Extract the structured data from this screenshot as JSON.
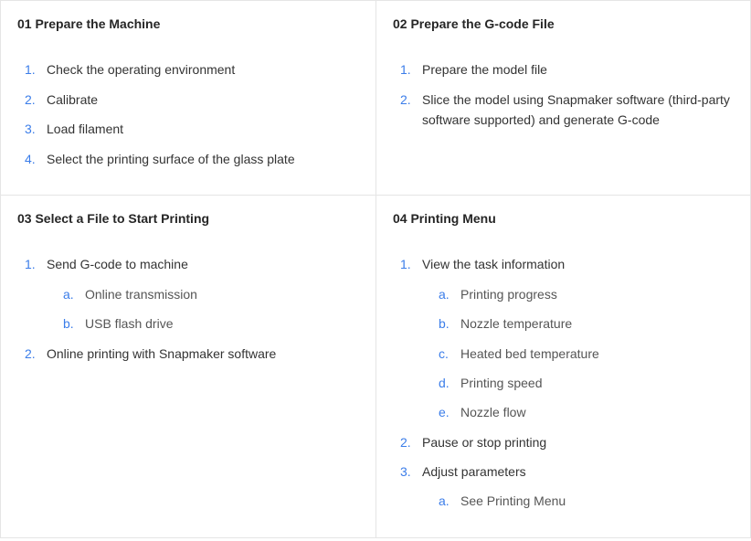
{
  "cells": [
    {
      "title": "01 Prepare the Machine",
      "items": [
        {
          "text": "Check the operating environment"
        },
        {
          "text": "Calibrate"
        },
        {
          "text": "Load filament"
        },
        {
          "text": "Select the printing surface of the glass plate"
        }
      ]
    },
    {
      "title": "02 Prepare the G-code File",
      "items": [
        {
          "text": "Prepare the model file"
        },
        {
          "text": "Slice the model using Snapmaker software (third-party software supported) and generate G-code"
        }
      ]
    },
    {
      "title": "03 Select a File to Start Printing",
      "items": [
        {
          "text": "Send G-code to machine",
          "subitems": [
            "Online transmission",
            "USB flash drive"
          ]
        },
        {
          "text": "Online printing with Snapmaker software"
        }
      ]
    },
    {
      "title": "04 Printing Menu",
      "items": [
        {
          "text": "View the task information",
          "subitems": [
            "Printing progress",
            "Nozzle temperature",
            "Heated bed temperature",
            "Printing speed",
            "Nozzle flow"
          ]
        },
        {
          "text": "Pause or stop printing"
        },
        {
          "text": "Adjust parameters",
          "subitems": [
            "See Printing Menu"
          ]
        }
      ]
    }
  ]
}
